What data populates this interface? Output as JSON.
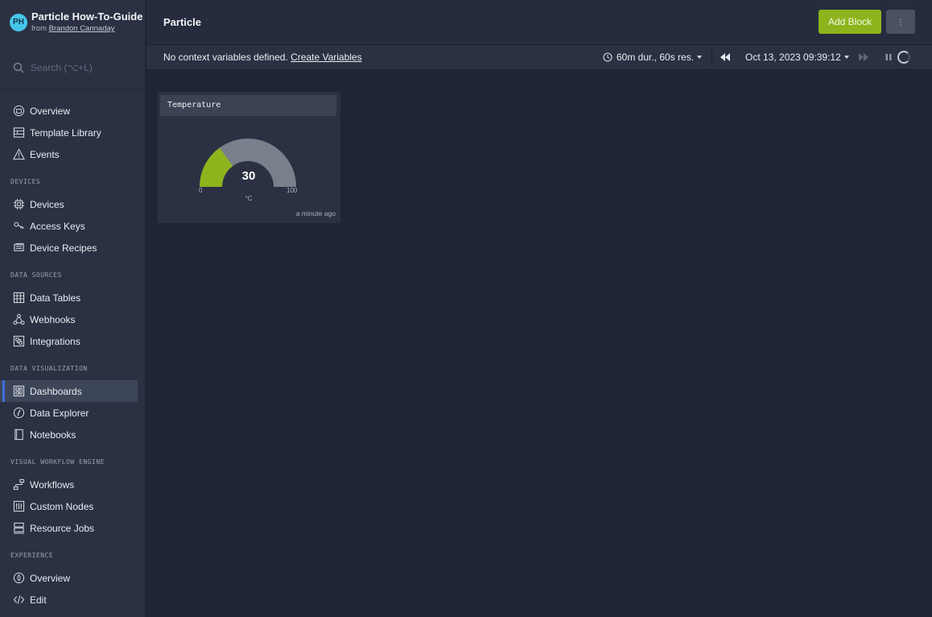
{
  "brand": {
    "initials": "PH",
    "title": "Particle How-To-Guide",
    "from_prefix": "from",
    "owner": "Brandon Cannaday"
  },
  "search": {
    "placeholder": "Search (⌥+L)"
  },
  "nav": {
    "top": [
      {
        "label": "Overview",
        "icon": "overview-icon"
      },
      {
        "label": "Template Library",
        "icon": "template-icon"
      },
      {
        "label": "Events",
        "icon": "warning-icon"
      }
    ],
    "devices": {
      "heading": "DEVICES",
      "items": [
        {
          "label": "Devices",
          "icon": "chip-icon"
        },
        {
          "label": "Access Keys",
          "icon": "key-icon"
        },
        {
          "label": "Device Recipes",
          "icon": "recipe-icon"
        }
      ]
    },
    "data_sources": {
      "heading": "DATA SOURCES",
      "items": [
        {
          "label": "Data Tables",
          "icon": "table-icon"
        },
        {
          "label": "Webhooks",
          "icon": "webhook-icon"
        },
        {
          "label": "Integrations",
          "icon": "integration-icon"
        }
      ]
    },
    "data_viz": {
      "heading": "DATA VISUALIZATION",
      "items": [
        {
          "label": "Dashboards",
          "icon": "dashboard-icon",
          "active": true
        },
        {
          "label": "Data Explorer",
          "icon": "compass-icon"
        },
        {
          "label": "Notebooks",
          "icon": "notebook-icon"
        }
      ]
    },
    "workflow": {
      "heading": "VISUAL WORKFLOW ENGINE",
      "items": [
        {
          "label": "Workflows",
          "icon": "workflow-icon"
        },
        {
          "label": "Custom Nodes",
          "icon": "custom-node-icon"
        },
        {
          "label": "Resource Jobs",
          "icon": "server-icon"
        }
      ]
    },
    "experience": {
      "heading": "EXPERIENCE",
      "items": [
        {
          "label": "Overview",
          "icon": "overview-drop-icon"
        },
        {
          "label": "Edit",
          "icon": "code-icon"
        }
      ]
    }
  },
  "header": {
    "title": "Particle",
    "add_block": "Add Block",
    "more": "⋮"
  },
  "context": {
    "message": "No context variables defined.",
    "link": "Create Variables",
    "duration": "60m dur., 60s res.",
    "timestamp": "Oct 13, 2023 09:39:12"
  },
  "widget": {
    "title": "Temperature",
    "value": 30,
    "value_text": "30",
    "min": "0",
    "max": "100",
    "unit": "°C",
    "updated": "a minute ago",
    "fill_color": "#8db41c",
    "track_color": "#7a808b"
  }
}
